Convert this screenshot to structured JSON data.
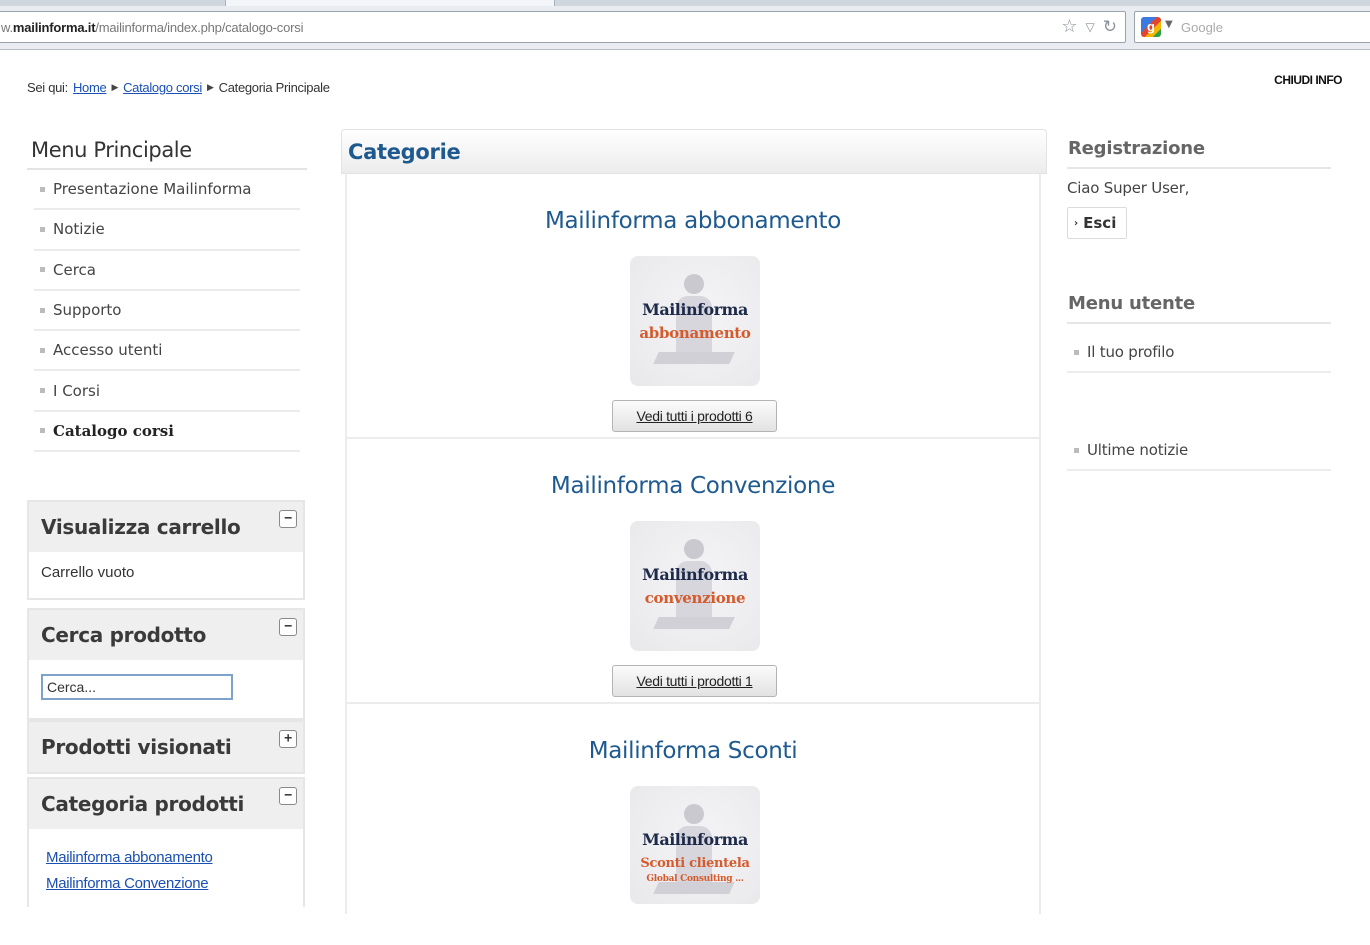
{
  "browser": {
    "url_prefix": "w.",
    "url_domain": "mailinforma.it",
    "url_path": "/mailinforma/index.php/catalogo-corsi",
    "search_placeholder": "Google",
    "search_engine_letter": "g"
  },
  "breadcrumb": {
    "prefix": "Sei qui:",
    "items": [
      "Home",
      "Catalogo corsi",
      "Categoria Principale"
    ],
    "separator": "▶"
  },
  "close_info": "CHIUDI INFO",
  "menu": {
    "title": "Menu Principale",
    "items": [
      "Presentazione Mailinforma",
      "Notizie",
      "Cerca",
      "Supporto",
      "Accesso utenti",
      "I Corsi",
      "Catalogo corsi"
    ]
  },
  "modules": {
    "cart": {
      "title": "Visualizza carrello",
      "toggle": "−",
      "content": "Carrello vuoto"
    },
    "search": {
      "title": "Cerca prodotto",
      "toggle": "−",
      "placeholder": "Cerca..."
    },
    "viewed": {
      "title": "Prodotti visionati",
      "toggle": "+"
    },
    "categories": {
      "title": "Categoria prodotti",
      "toggle": "−",
      "links": [
        "Mailinforma abbonamento",
        "Mailinforma Convenzione"
      ]
    }
  },
  "main": {
    "title": "Categorie",
    "categories": [
      {
        "title": "Mailinforma abbonamento",
        "thumb_line1": "Mailinforma",
        "thumb_line2": "abbonamento",
        "button": "Vedi tutti i prodotti 6"
      },
      {
        "title": "Mailinforma Convenzione",
        "thumb_line1": "Mailinforma",
        "thumb_line2": "convenzione",
        "button": "Vedi tutti i prodotti 1"
      },
      {
        "title": "Mailinforma Sconti",
        "thumb_line1": "Mailinforma",
        "thumb_line2": "Sconti clientela",
        "thumb_line3": "Global Consulting ..."
      }
    ]
  },
  "right": {
    "registration_title": "Registrazione",
    "greeting": "Ciao Super User,",
    "logout": "Esci",
    "user_menu_title": "Menu utente",
    "profile": "Il tuo profilo",
    "latest_news": "Ultime notizie"
  }
}
